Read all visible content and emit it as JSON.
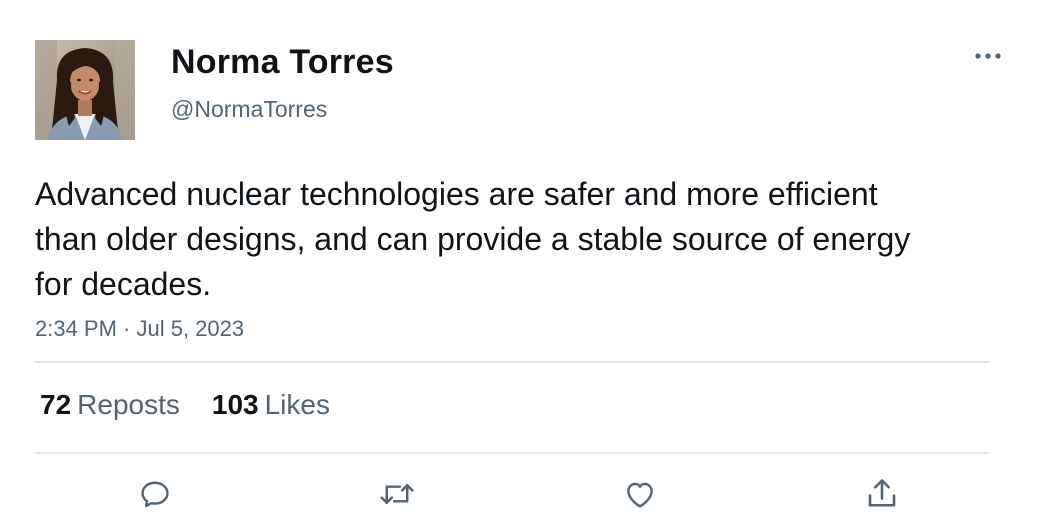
{
  "user": {
    "display_name": "Norma Torres",
    "handle": "@NormaTorres",
    "avatar": "profile-photo"
  },
  "tweet": {
    "text": "Advanced nuclear technologies are safer and more efficient than older designs, and can provide a stable source of energy for decades.",
    "timestamp": "2:34 PM · Jul 5, 2023"
  },
  "stats": {
    "reposts_count": "72",
    "reposts_label": "Reposts",
    "likes_count": "103",
    "likes_label": "Likes"
  },
  "icons": {
    "more": "more-dots-icon",
    "reply": "reply-icon",
    "repost": "repost-icon",
    "like": "heart-icon",
    "share": "share-icon"
  },
  "colors": {
    "text_primary": "#0f1419",
    "text_secondary": "#536471",
    "divider": "#e1e5e9"
  }
}
